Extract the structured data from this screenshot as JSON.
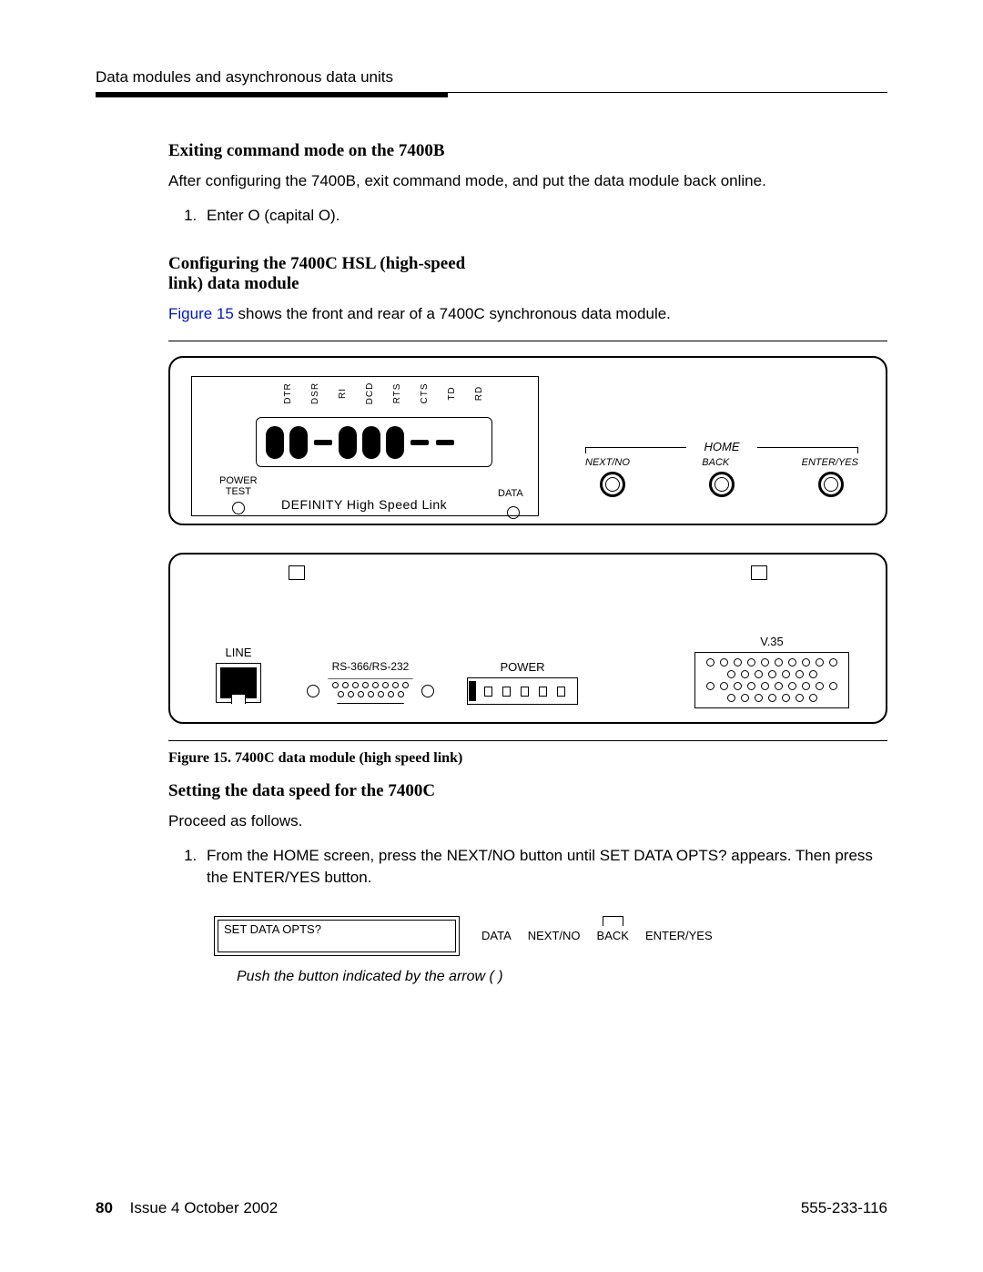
{
  "header": {
    "section": "Data modules and asynchronous data units"
  },
  "sect1": {
    "title": "Exiting command mode on the 7400B",
    "para": "After configuring the 7400B, exit command mode, and put the data module back online.",
    "step1": "Enter O (capital O)."
  },
  "sect2": {
    "title": "Configuring the 7400C HSL (high-speed link) data module",
    "figref": "Figure 15",
    "para_rest": " shows the front and rear of a 7400C synchronous data module."
  },
  "front_panel": {
    "leds": [
      "DTR",
      "DSR",
      "RI",
      "DCD",
      "RTS",
      "CTS",
      "TD",
      "RD"
    ],
    "power_test": "POWER\nTEST",
    "product_label": "DEFINITY High Speed Link",
    "data_label": "DATA",
    "home": "HOME",
    "buttons": [
      "NEXT/NO",
      "BACK",
      "ENTER/YES"
    ]
  },
  "rear_panel": {
    "line": "LINE",
    "serial": "RS-366/RS-232",
    "power": "POWER",
    "v35": "V.35"
  },
  "fig_caption": "Figure 15.    7400C data module (high speed link)",
  "sect3": {
    "title": "Setting the data speed for the 7400C",
    "para": "Proceed as follows.",
    "step1": "From the HOME screen, press the NEXT/NO button until SET DATA OPTS? appears. Then press the ENTER/YES button."
  },
  "lcd": {
    "text": "SET DATA OPTS?",
    "labels": [
      "DATA",
      "NEXT/NO",
      "BACK",
      "ENTER/YES"
    ]
  },
  "push_note": "Push the button indicated by the arrow (     )",
  "footer": {
    "page": "80",
    "issue": "Issue 4   October 2002",
    "docnum": "555-233-116"
  }
}
